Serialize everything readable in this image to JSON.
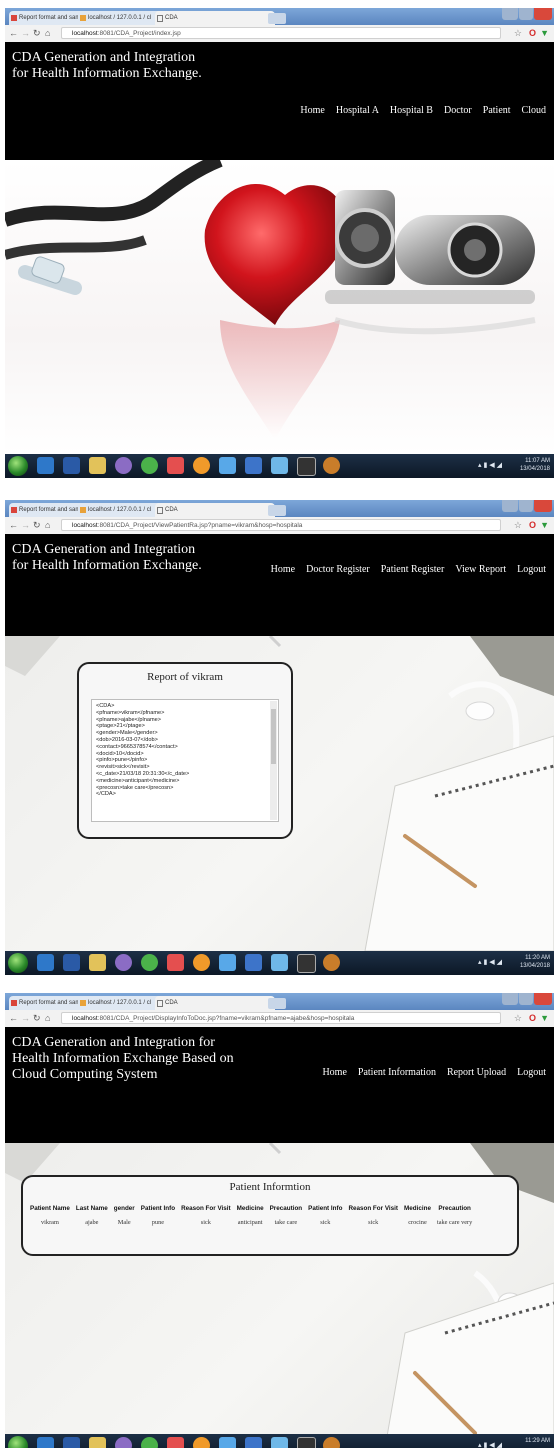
{
  "browser": {
    "tabs": [
      {
        "label": "Report format and sam"
      },
      {
        "label": "localhost / 127.0.0.1 / cl"
      },
      {
        "label": "CDA"
      }
    ],
    "urls": [
      {
        "host": "localhost",
        "path": ":8081/CDA_Project/index.jsp"
      },
      {
        "host": "localhost",
        "path": ":8081/CDA_Project/ViewPatientRa.jsp?pname=vikram&hosp=hospitala"
      },
      {
        "host": "localhost",
        "path": ":8081/CDA_Project/DisplayInfoToDoc.jsp?fname=vikram&pfname=ajabe&hosp=hospitala"
      }
    ]
  },
  "screens": [
    {
      "title": "CDA Generation and Integration for Health Information Exchange.",
      "nav": [
        "Home",
        "Hospital A",
        "Hospital B",
        "Doctor",
        "Patient",
        "Cloud"
      ],
      "clock": {
        "time": "11:07 AM",
        "date": "13/04/2018"
      }
    },
    {
      "title": "CDA Generation and Integration for Health Information Exchange.",
      "nav": [
        "Home",
        "Doctor Register",
        "Patient Register",
        "View Report",
        "Logout"
      ],
      "clock": {
        "time": "11:20 AM",
        "date": "13/04/2018"
      },
      "report": {
        "heading": "Report of vikram",
        "xml_lines": [
          "<CDA>",
          "<pfname>vikram</pfname>",
          "<plname>ajabe</plname>",
          "<ptage>21</ptage>",
          "<gender>Male</gender>",
          "<dob>2016-03-07</dob>",
          "<contact>9665378574</contact>",
          "<docid>10</docid>",
          "<pinfo>pune</pinfo>",
          "<revisit>sick</revisit>",
          "<c_date>21/03/18 20:31:30</c_date>",
          "<medicine>anticipant</medicine>",
          "<precosn>take care</precosn>",
          "</CDA>"
        ]
      }
    },
    {
      "title": "CDA Generation and Integration for Health Information Exchange Based on Cloud Computing System",
      "nav": [
        "Home",
        "Patient Information",
        "Report Upload",
        "Logout"
      ],
      "clock": {
        "time": "11:29 AM",
        "date": ""
      },
      "table": {
        "heading": "Patient Informtion",
        "columns": [
          "Patient Name",
          "Last Name",
          "gender",
          "Patient Info",
          "Reason For Visit",
          "Medicine",
          "Precaution",
          "Patient Info",
          "Reason For Visit",
          "Medicine",
          "Precaution"
        ],
        "row": [
          "vikram",
          "ajabe",
          "Male",
          "pune",
          "sick",
          "anticipant",
          "take care",
          "sick",
          "sick",
          "crocine",
          "take care very"
        ]
      }
    }
  ],
  "colors": {
    "header_bg": "#000000",
    "taskbar": "#13243a",
    "heart": "#c8141b"
  }
}
